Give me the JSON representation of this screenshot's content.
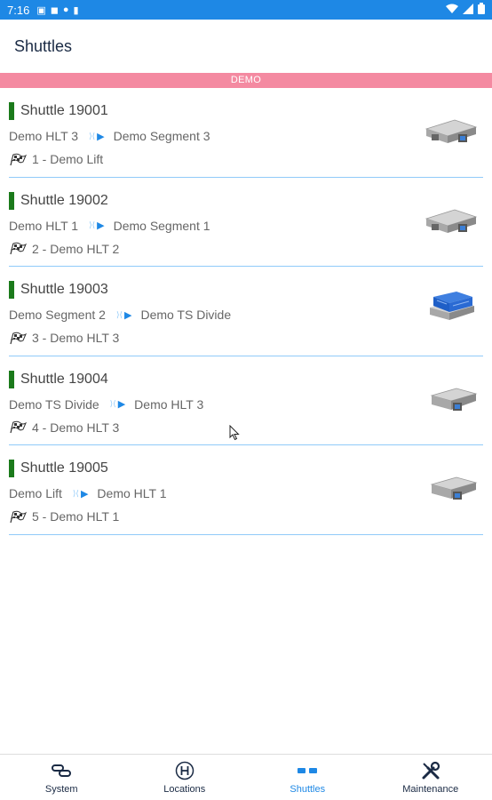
{
  "status_bar": {
    "time": "7:16"
  },
  "app_bar": {
    "title": "Shuttles"
  },
  "banner": {
    "label": "DEMO",
    "color": "#f48aa1"
  },
  "colors": {
    "accent": "#1e88e5",
    "active_marker": "#1b7a1b",
    "divider": "#90caf9"
  },
  "shuttles": [
    {
      "name": "Shuttle 19001",
      "from": "Demo HLT 3",
      "to": "Demo Segment 3",
      "destination": "1 - Demo Lift",
      "image": "grey-shuttle-icon"
    },
    {
      "name": "Shuttle 19002",
      "from": "Demo HLT 1",
      "to": "Demo Segment 1",
      "destination": "2 - Demo HLT 2",
      "image": "grey-shuttle-icon"
    },
    {
      "name": "Shuttle 19003",
      "from": "Demo Segment 2",
      "to": "Demo TS Divide",
      "destination": "3 - Demo HLT 3",
      "image": "blue-crate-shuttle-icon"
    },
    {
      "name": "Shuttle 19004",
      "from": "Demo TS Divide",
      "to": "Demo HLT 3",
      "destination": "4 - Demo HLT 3",
      "image": "grey-shuttle-icon"
    },
    {
      "name": "Shuttle 19005",
      "from": "Demo Lift",
      "to": "Demo HLT 1",
      "destination": "5 - Demo HLT 1",
      "image": "grey-shuttle-icon"
    }
  ],
  "bottom_nav": [
    {
      "label": "System",
      "icon": "link-icon",
      "active": false
    },
    {
      "label": "Locations",
      "icon": "location-h-icon",
      "active": false
    },
    {
      "label": "Shuttles",
      "icon": "shuttle-icon",
      "active": true
    },
    {
      "label": "Maintenance",
      "icon": "tools-icon",
      "active": false
    }
  ]
}
